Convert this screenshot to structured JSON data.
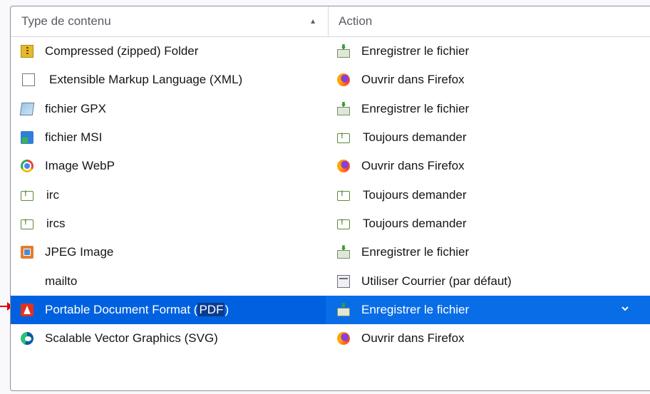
{
  "header": {
    "col1": "Type de contenu",
    "col2": "Action"
  },
  "rows": [
    {
      "type": "Compressed (zipped) Folder",
      "type_icon": "zip-folder-icon",
      "action": "Enregistrer le fichier",
      "action_icon": "save-file-icon"
    },
    {
      "type": "Extensible Markup Language (XML)",
      "type_icon": "document-icon",
      "action": "Ouvrir dans Firefox",
      "action_icon": "firefox-icon"
    },
    {
      "type": "fichier GPX",
      "type_icon": "gpx-file-icon",
      "action": "Enregistrer le fichier",
      "action_icon": "save-file-icon"
    },
    {
      "type": "fichier MSI",
      "type_icon": "msi-installer-icon",
      "action": "Toujours demander",
      "action_icon": "ask-icon"
    },
    {
      "type": "Image WebP",
      "type_icon": "chrome-icon",
      "action": "Ouvrir dans Firefox",
      "action_icon": "firefox-icon"
    },
    {
      "type": "irc",
      "type_icon": "chat-icon",
      "action": "Toujours demander",
      "action_icon": "ask-icon"
    },
    {
      "type": "ircs",
      "type_icon": "chat-icon",
      "action": "Toujours demander",
      "action_icon": "ask-icon"
    },
    {
      "type": "JPEG Image",
      "type_icon": "image-icon",
      "action": "Enregistrer le fichier",
      "action_icon": "save-file-icon"
    },
    {
      "type": "mailto",
      "type_icon": "",
      "action": "Utiliser Courrier (par défaut)",
      "action_icon": "mail-app-icon"
    },
    {
      "type_prefix": "Portable Document Format (",
      "type_highlight": "PDF",
      "type_suffix": ")",
      "type_icon": "pdf-icon",
      "action": "Enregistrer le fichier",
      "action_icon": "save-file-icon",
      "selected": true
    },
    {
      "type": "Scalable Vector Graphics (SVG)",
      "type_icon": "edge-icon",
      "action": "Ouvrir dans Firefox",
      "action_icon": "firefox-icon"
    }
  ],
  "colors": {
    "selected_row": "#0061e0",
    "selected_action": "#0a6de8",
    "highlight": "#0b3c8c",
    "pointer_arrow": "#e00000"
  }
}
